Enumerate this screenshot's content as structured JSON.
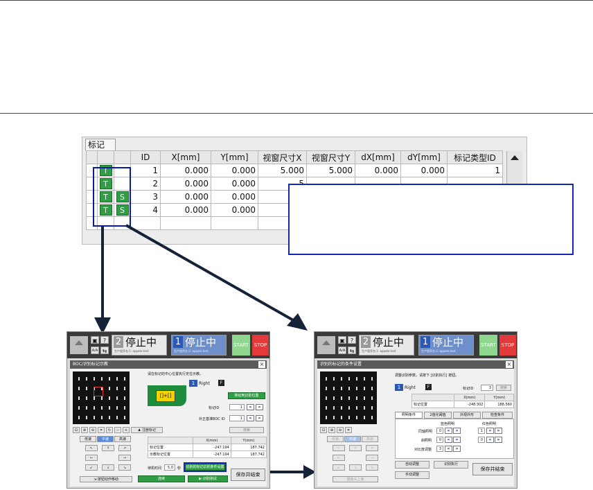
{
  "marker_panel": {
    "tab_label": "标记",
    "columns": [
      "",
      "",
      "",
      "ID",
      "X[mm]",
      "Y[mm]",
      "视窗尺寸X",
      "视窗尺寸Y",
      "dX[mm]",
      "dY[mm]",
      "标记类型ID"
    ],
    "rows": [
      {
        "f1": "T",
        "f2": "",
        "id": "1",
        "x": "0.000",
        "y": "0.000",
        "wx": "5.000",
        "wy": "5.000",
        "dx": "0.000",
        "dy": "0.000",
        "type": "1"
      },
      {
        "f1": "T",
        "f2": "",
        "id": "2",
        "x": "0.000",
        "y": "0.000",
        "wx": "5",
        "wy": "",
        "dx": "",
        "dy": "",
        "type": ""
      },
      {
        "f1": "T",
        "f2": "S",
        "id": "3",
        "x": "0.000",
        "y": "0.000",
        "wx": "5",
        "wy": "",
        "dx": "",
        "dy": "",
        "type": ""
      },
      {
        "f1": "T",
        "f2": "S",
        "id": "4",
        "x": "0.000",
        "y": "0.000",
        "wx": "5",
        "wy": "",
        "dx": "",
        "dy": "",
        "type": ""
      },
      {
        "f1": "",
        "f2": "",
        "id": "",
        "x": "",
        "y": "",
        "wx": "",
        "wy": "",
        "dx": "",
        "dy": "",
        "type": ""
      }
    ]
  },
  "topbar": {
    "status1_num": "2",
    "status1_text": "停止中",
    "status2_num": "1",
    "status2_text": "停止中",
    "sub_line1": "生产程序名:1: appate.test",
    "sub_line2": "生产程序名:2: appate.test",
    "start": "START",
    "stop": "STOP",
    "btn_a": "A/A",
    "btn_q": "?"
  },
  "left_dialog": {
    "title": "BOC/识别标记示教",
    "instruction": "请在标记的中心位置执行定位示教。",
    "camera": "1",
    "side": "Right",
    "f": "F",
    "move_btn": "移动到识别位置",
    "mark_id_label": "标记ID",
    "mark_id_value": "1",
    "boc_label": "补正基准BOC ID",
    "boc_value": "1",
    "reg_btn": "注册标记",
    "search_btn": "搜索",
    "speed_low": "低速",
    "speed_mid": "中速",
    "speed_high": "高速",
    "col_x": "X(mm)",
    "col_y": "Y(mm)",
    "row1_label": "标记位置",
    "row1_x": "-247.194",
    "row1_y": "187.742",
    "row2_label": "示教标记位置",
    "row2_x": "-247.194",
    "row2_y": "187.742",
    "wait_label": "待机时间",
    "wait_value": "5.0",
    "wait_unit": "秒",
    "cond_btn": "识别的标记识别条件设置",
    "continue_btn": "连续",
    "test_btn": "识别测试",
    "motion_btn": "按钮动作移动",
    "save_btn": "保存并结束"
  },
  "right_dialog": {
    "title": "识别的标记的条件设置",
    "instruction": "调整识别参数，请按下 [识别执行] 按钮。",
    "camera": "1",
    "side": "Right",
    "f": "F",
    "mark_id_label": "标记ID",
    "mark_id_value": "3",
    "search_btn": "搜索",
    "col_x": "X(mm)",
    "col_y": "Y(mm)",
    "row_label": "标记位置",
    "row_x": "-248.302",
    "row_y": "188.560",
    "tabs": [
      "照明条件",
      "2值化阈值",
      "外观外形",
      "检查条件"
    ],
    "blue_label": "蓝色照明",
    "red_label": "红色照明",
    "l1_label": "同轴照明",
    "l1_b": "0",
    "l1_r": "1",
    "l2_label": "斜照明",
    "l2_b": "0",
    "l2_r": "0",
    "l3_label": "对比度调整",
    "l3_b": "3",
    "speed_low": "低速",
    "speed_mid": "中速",
    "speed_high": "高速",
    "teach_btn": "摄像头上离",
    "auto_btn": "自动调整",
    "exec_btn": "识别执行",
    "manual_btn": "手动调整",
    "save_btn": "保存并结束"
  },
  "colors": {
    "flag_green": "#2f9e44",
    "highlight_blue": "#1525b5",
    "arrow": "#152238",
    "stop_red": "#e23a3a"
  }
}
